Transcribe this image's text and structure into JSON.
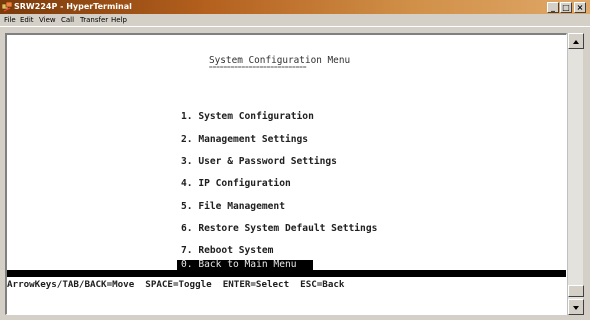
{
  "window": {
    "title": "SRW224P - HyperTerminal",
    "minimize": "_",
    "maximize": "□",
    "close": "×",
    "accent": "#b4601e"
  },
  "menubar": {
    "items": [
      "File",
      "Edit",
      "View",
      "Call",
      "Transfer",
      "Help"
    ]
  },
  "terminal": {
    "menu_title": "System Configuration Menu",
    "menu_title_underline": "===========================",
    "items": [
      "1. System Configuration",
      "2. Management Settings",
      "3. User & Password Settings",
      "4. IP Configuration",
      "5. File Management",
      "6. Restore System Default Settings",
      "7. Reboot System"
    ],
    "selected_item": "0. Back to Main Menu",
    "help_line": "ArrowKeys/TAB/BACK=Move  SPACE=Toggle  ENTER=Select  ESC=Back"
  },
  "scrollbar": {
    "up_icon": "up-arrow-icon",
    "down_icon": "down-arrow-icon"
  }
}
